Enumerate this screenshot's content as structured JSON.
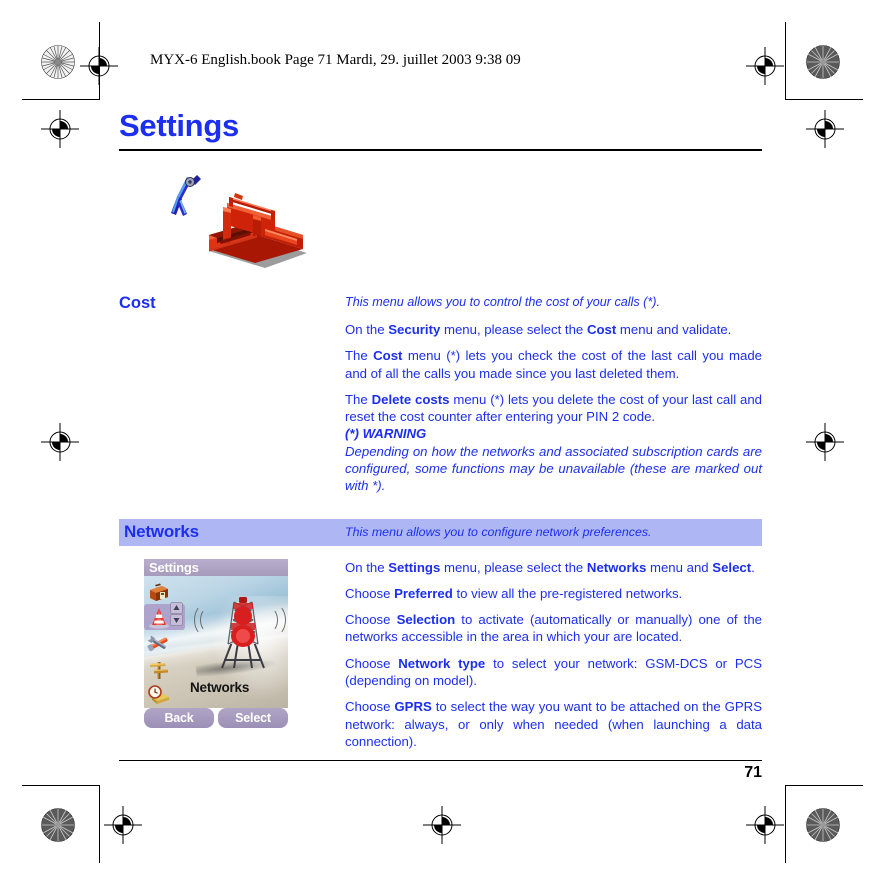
{
  "print_header": "MYX-6 English.book  Page 71  Mardi, 29. juillet 2003  9:38 09",
  "chapter": {
    "title": "Settings"
  },
  "illustration": {
    "name": "toolbox-illustration",
    "description": "Red isometric toolbox with blue pliers"
  },
  "cost_section": {
    "heading": "Cost",
    "intro": "This menu allows you to control the cost of your calls (*).",
    "paragraphs": [
      {
        "parts": [
          {
            "text": "On the ",
            "bold": false
          },
          {
            "text": "Security",
            "bold": true
          },
          {
            "text": " menu, please select the ",
            "bold": false
          },
          {
            "text": "Cost",
            "bold": true
          },
          {
            "text": " menu and validate.",
            "bold": false
          }
        ]
      },
      {
        "parts": [
          {
            "text": "The ",
            "bold": false
          },
          {
            "text": "Cost",
            "bold": true
          },
          {
            "text": " menu (*) lets you check the cost of the last call you made and of all the calls you made since you last deleted them.",
            "bold": false
          }
        ]
      },
      {
        "parts": [
          {
            "text": "The ",
            "bold": false
          },
          {
            "text": "Delete costs",
            "bold": true
          },
          {
            "text": " menu (*) lets you delete the cost of your last call and reset the cost counter after entering your PIN 2 code.",
            "bold": false
          }
        ]
      }
    ],
    "warning_title": "(*) WARNING",
    "warning_body": "Depending on how the networks and associated subscription cards are configured, some functions may be unavailable (these are marked out with *)."
  },
  "networks_section": {
    "banner_title": "Networks",
    "banner_subtitle": "This menu allows you to configure network preferences.",
    "paragraphs": [
      {
        "parts": [
          {
            "text": "On the ",
            "bold": false
          },
          {
            "text": "Settings",
            "bold": true
          },
          {
            "text": " menu, please select the ",
            "bold": false
          },
          {
            "text": "Networks",
            "bold": true
          },
          {
            "text": " menu and ",
            "bold": false
          },
          {
            "text": "Select",
            "bold": true
          },
          {
            "text": ".",
            "bold": false
          }
        ]
      },
      {
        "parts": [
          {
            "text": "Choose ",
            "bold": false
          },
          {
            "text": "Preferred",
            "bold": true
          },
          {
            "text": " to view all the pre-registered networks.",
            "bold": false
          }
        ]
      },
      {
        "parts": [
          {
            "text": "Choose ",
            "bold": false
          },
          {
            "text": "Selection",
            "bold": true
          },
          {
            "text": " to activate (automatically or manually) one of the networks accessible in the area in which your are located.",
            "bold": false
          }
        ]
      },
      {
        "parts": [
          {
            "text": "Choose ",
            "bold": false
          },
          {
            "text": "Network type",
            "bold": true
          },
          {
            "text": " to select your network: GSM-DCS or PCS (depending on model).",
            "bold": false
          }
        ]
      },
      {
        "parts": [
          {
            "text": "Choose ",
            "bold": false
          },
          {
            "text": "GPRS",
            "bold": true
          },
          {
            "text": " to select the way you want to be attached on the GPRS network: always, or only when needed (when launching a data connection).",
            "bold": false
          }
        ]
      }
    ]
  },
  "phone_screenshot": {
    "title": "Settings",
    "selected_label": "Networks",
    "softkey_left": "Back",
    "softkey_right": "Select",
    "icons": [
      "toolbox-icon",
      "traffic-cone-icon",
      "crossed-tools-icon",
      "signpost-icon",
      "clock-book-icon"
    ],
    "selected_icon_index": 1
  },
  "footer": {
    "page_number": "71"
  },
  "colors": {
    "text_blue": "#1c2ff0",
    "banner_bg": "#aeb7f3",
    "phone_titlebar": "#a79bbd",
    "softkey": "#9c8fb6"
  }
}
